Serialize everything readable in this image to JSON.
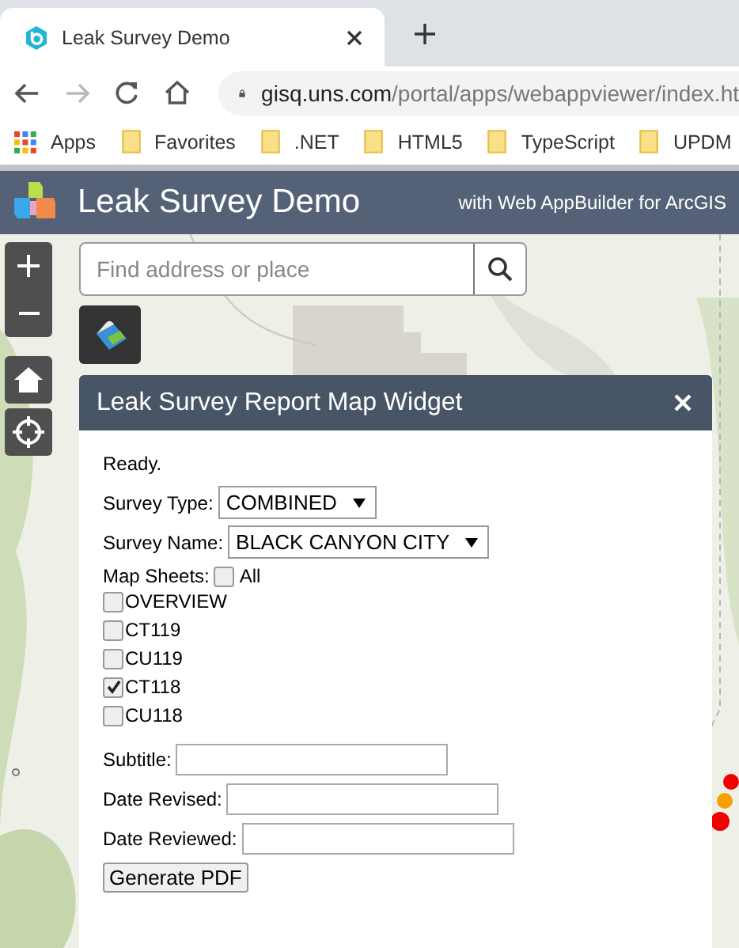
{
  "browser": {
    "tab": {
      "title": "Leak Survey Demo"
    },
    "url": {
      "host": "gisq.uns.com",
      "path": "/portal/apps/webappviewer/index.ht"
    },
    "bookmarks": [
      {
        "label": "Apps",
        "kind": "apps"
      },
      {
        "label": "Favorites",
        "kind": "folder"
      },
      {
        "label": ".NET",
        "kind": "folder"
      },
      {
        "label": "HTML5",
        "kind": "folder"
      },
      {
        "label": "TypeScript",
        "kind": "folder"
      },
      {
        "label": "UPDM",
        "kind": "folder"
      }
    ]
  },
  "app": {
    "title": "Leak Survey Demo",
    "subtitle": "with Web AppBuilder for ArcGIS"
  },
  "map": {
    "search": {
      "placeholder": "Find address or place"
    }
  },
  "widget": {
    "title": "Leak Survey Report Map Widget",
    "status": "Ready.",
    "selects": [
      {
        "label": "Survey Type:",
        "value": "COMBINED"
      },
      {
        "label": "Survey Name:",
        "value": "BLACK CANYON CITY"
      }
    ],
    "map_sheets": {
      "label": "Map Sheets:",
      "all": {
        "label": "All",
        "checked": false
      },
      "sheets": [
        {
          "label": "OVERVIEW",
          "checked": false
        },
        {
          "label": "CT119",
          "checked": false
        },
        {
          "label": "CU119",
          "checked": false
        },
        {
          "label": "CT118",
          "checked": true
        },
        {
          "label": "CU118",
          "checked": false
        }
      ]
    },
    "fields": [
      {
        "label": "Subtitle:"
      },
      {
        "label": "Date Revised:"
      },
      {
        "label": "Date Reviewed:"
      }
    ],
    "button": "Generate PDF"
  }
}
